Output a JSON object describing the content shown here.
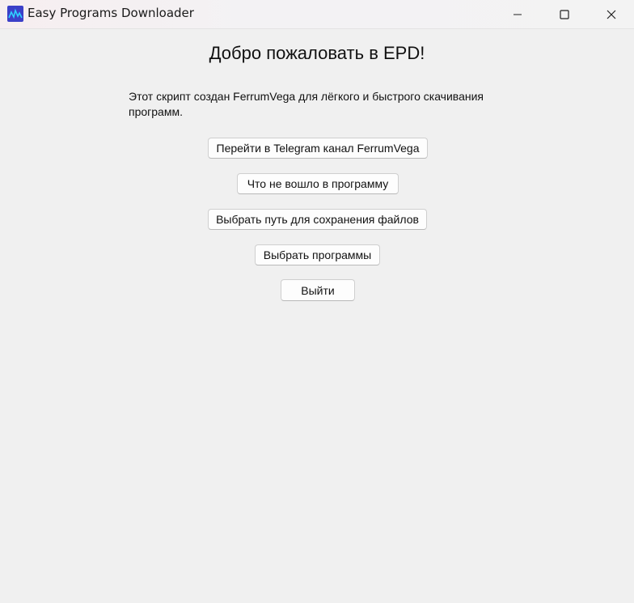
{
  "window": {
    "title": "Easy Programs Downloader",
    "icon": "app-logo-icon",
    "controls": {
      "minimize_icon": "minimize-icon",
      "maximize_icon": "maximize-icon",
      "close_icon": "close-icon"
    }
  },
  "main": {
    "heading": "Добро пожаловать в EPD!",
    "description": "Этот скрипт создан FerrumVega для лёгкого и быстрого скачивания программ.",
    "buttons": [
      {
        "label": "Перейти в Telegram канал FerrumVega"
      },
      {
        "label": "Что не вошло в программу"
      },
      {
        "label": "Выбрать путь для сохранения файлов"
      },
      {
        "label": "Выбрать программы"
      },
      {
        "label": "Выйти"
      }
    ]
  },
  "colors": {
    "background": "#f0f0f0",
    "app_icon_bg": "#3b3fc8",
    "app_icon_line": "#2fd0ff"
  }
}
